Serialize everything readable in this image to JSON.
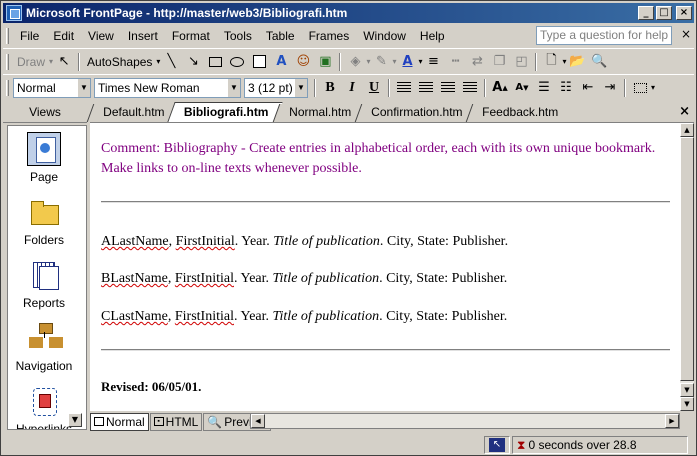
{
  "window": {
    "title": "Microsoft FrontPage - http://master/web3/Bibliografi.htm",
    "min_icon": "minimize-icon",
    "max_icon": "maximize-icon",
    "close_icon": "close-icon"
  },
  "menubar": {
    "items": [
      "File",
      "Edit",
      "View",
      "Insert",
      "Format",
      "Tools",
      "Table",
      "Frames",
      "Window",
      "Help"
    ],
    "help_placeholder": "Type a question for help"
  },
  "toolbar_drawing": {
    "draw_label": "Draw",
    "autoshapes_label": "AutoShapes"
  },
  "toolbar_format": {
    "style_value": "Normal",
    "font_value": "Times New Roman",
    "size_value": "3  (12 pt)",
    "bold": "B",
    "italic": "I",
    "underline": "U"
  },
  "views": {
    "header": "Views",
    "items": [
      {
        "label": "Page",
        "icon": "page-view-icon"
      },
      {
        "label": "Folders",
        "icon": "folders-view-icon"
      },
      {
        "label": "Reports",
        "icon": "reports-view-icon"
      },
      {
        "label": "Navigation",
        "icon": "navigation-view-icon"
      },
      {
        "label": "Hyperlinks",
        "icon": "hyperlinks-view-icon"
      }
    ]
  },
  "tabs": {
    "items": [
      "Default.htm",
      "Bibliografi.htm",
      "Normal.htm",
      "Confirmation.htm",
      "Feedback.htm"
    ],
    "active": "Bibliografi.htm"
  },
  "document": {
    "comment": "Comment: Bibliography - Create entries in alphabetical order, each with its own unique bookmark. Make links to on-line texts whenever possible.",
    "entries": [
      {
        "last": "ALastName",
        "first": "FirstInitial",
        "year": ". Year. ",
        "title": "Title of publication",
        "rest": ". City, State: Publisher."
      },
      {
        "last": "BLastName",
        "first": "FirstInitial",
        "year": ". Year. ",
        "title": "Title of publication",
        "rest": ". City, State: Publisher."
      },
      {
        "last": "CLastName",
        "first": "FirstInitial",
        "year": ". Year. ",
        "title": "Title of publication",
        "rest": ". City, State: Publisher."
      }
    ],
    "comma": ", ",
    "revised": "Revised: 06/05/01."
  },
  "view_tabs": {
    "normal": "Normal",
    "html": "HTML",
    "preview": "Preview"
  },
  "status": {
    "download_time": "0 seconds over 28.8"
  }
}
